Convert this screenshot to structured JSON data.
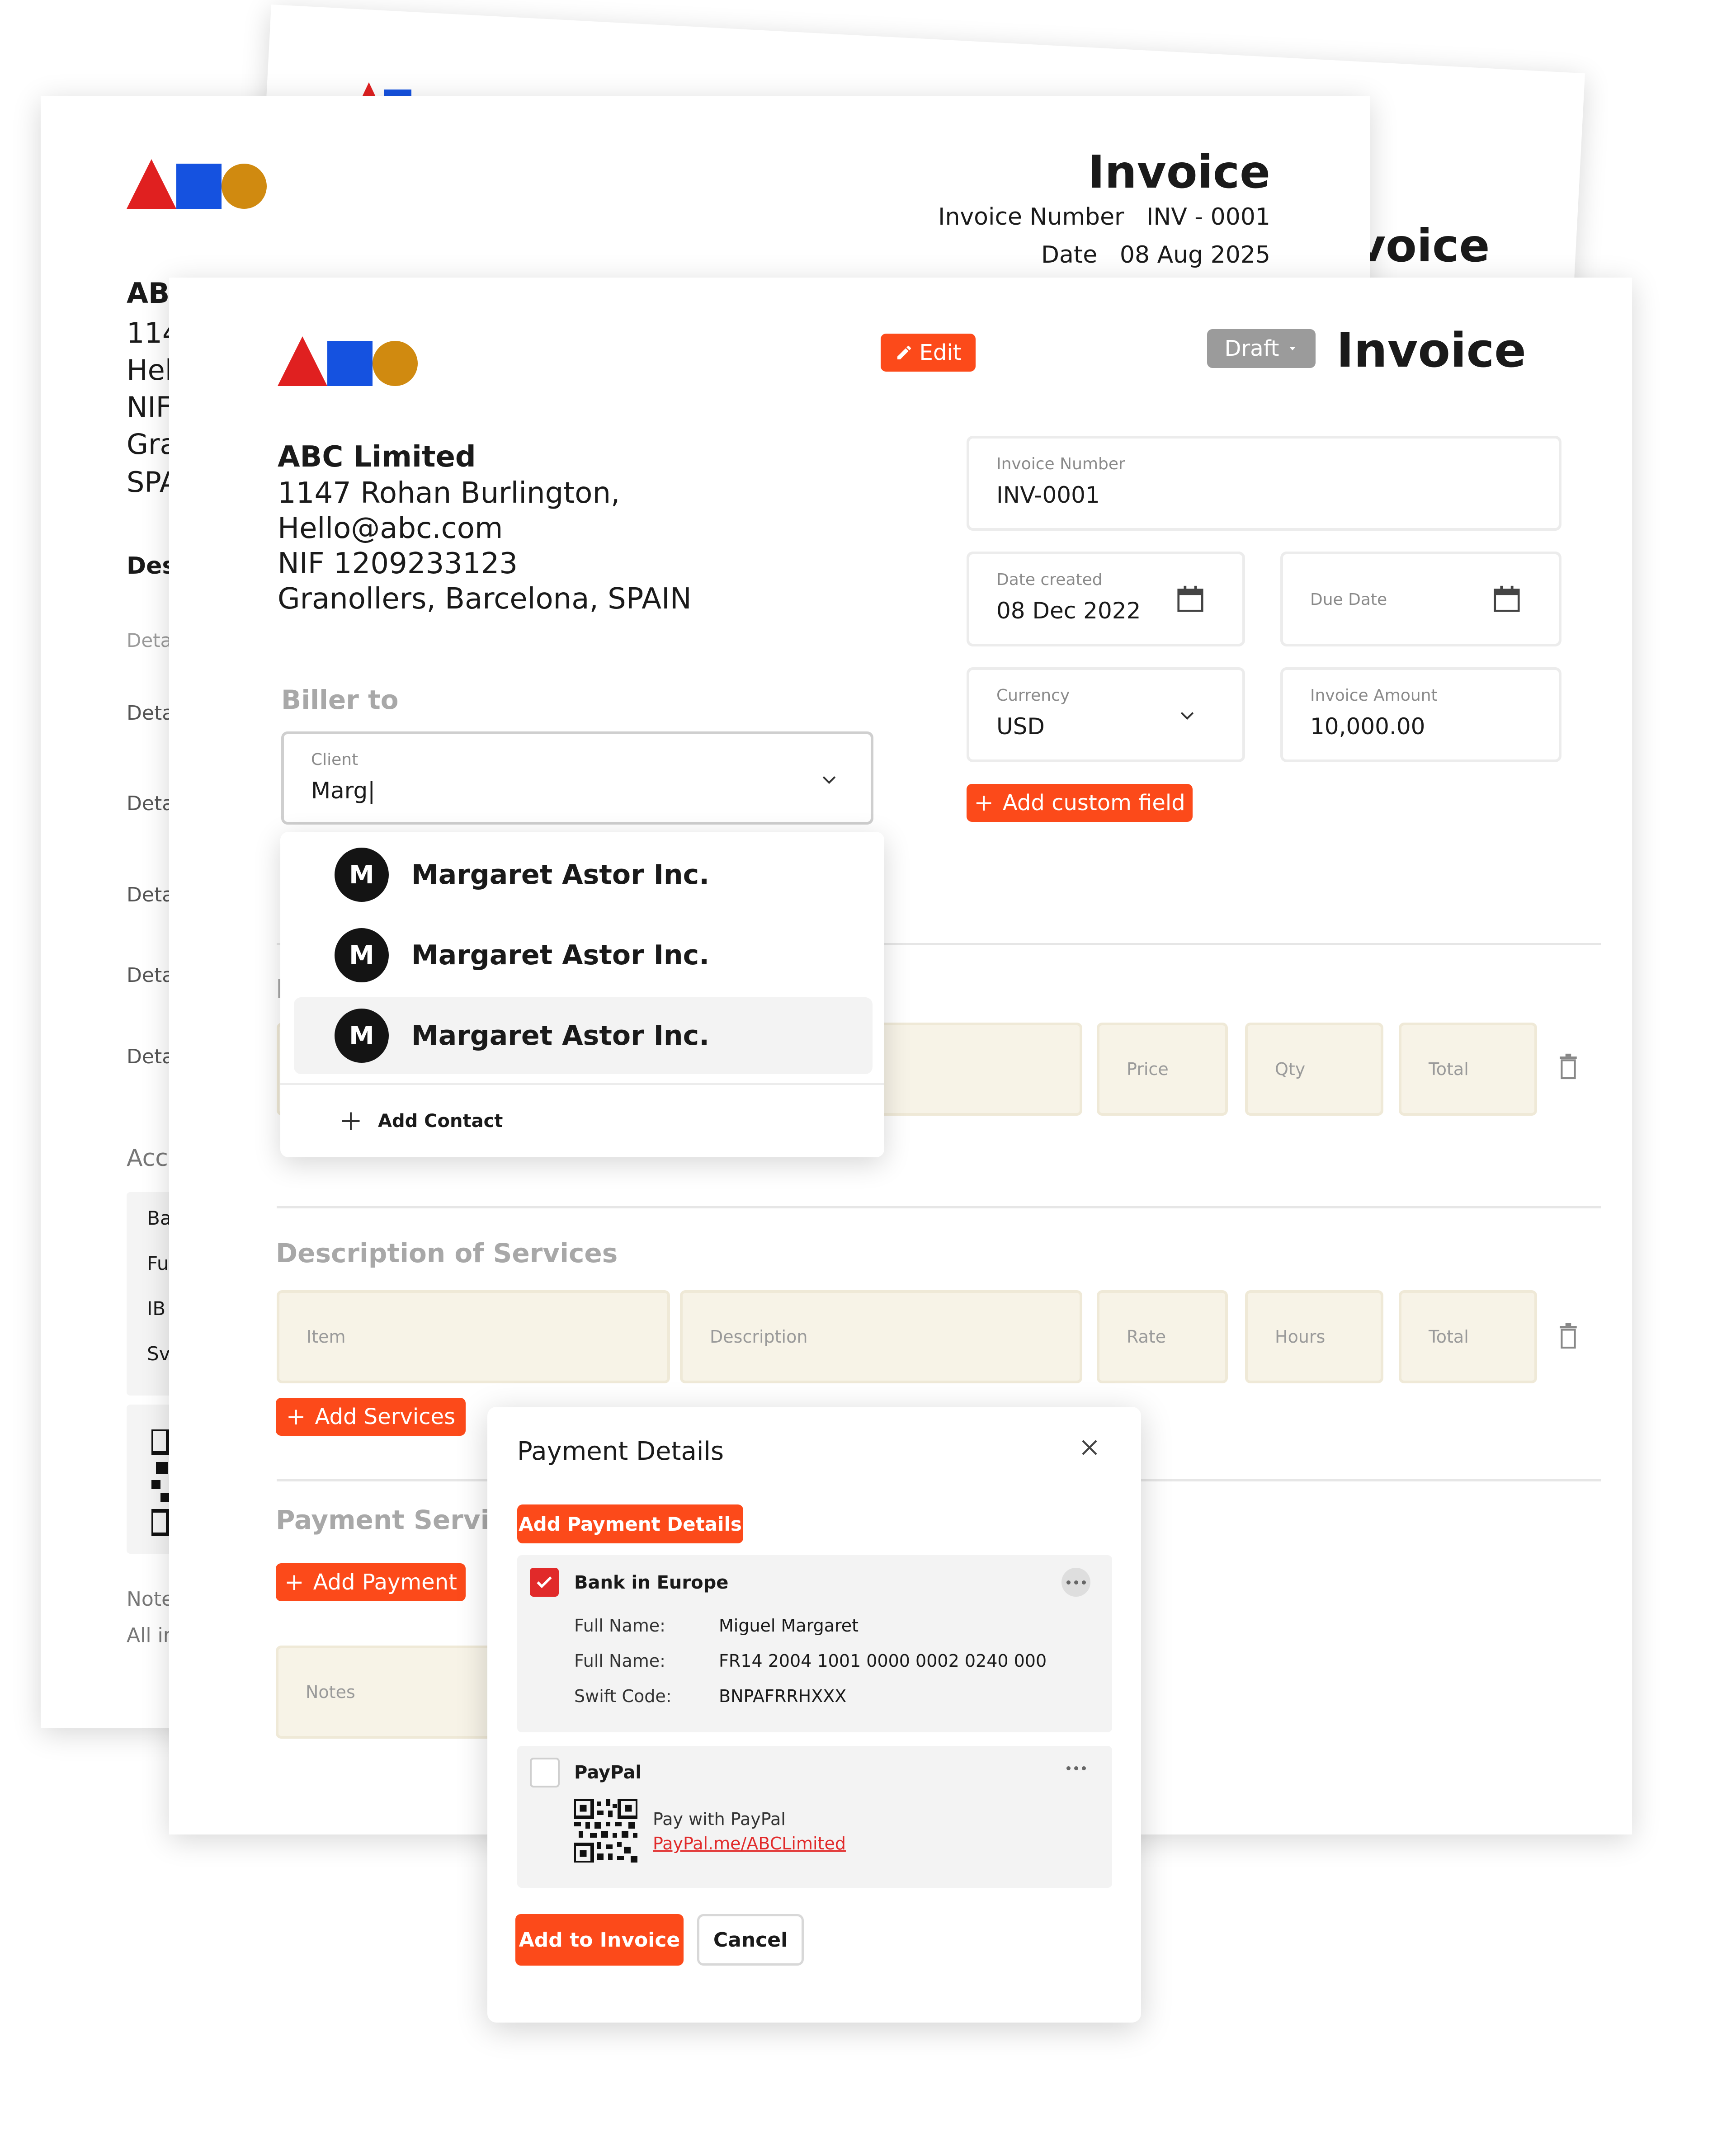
{
  "colors": {
    "accent": "#fc4a1a",
    "draft": "#9b9b9b",
    "logo_red": "#e02020",
    "logo_blue": "#1552e0",
    "logo_yellow": "#d08a10",
    "beige": "#f7f3e7"
  },
  "back_invoice": {
    "title": "Invoice",
    "number_label": "Invoice Number",
    "number_value": "INV - 0001",
    "date_label": "Date",
    "date_value": "08 Aug 2025",
    "left_fragments": [
      "AB",
      "114",
      "Hel",
      "NIF",
      "Gra",
      "SPA"
    ],
    "des": "Des",
    "rows": [
      "Deta",
      "Deta",
      "Deta",
      "Deta",
      "Deta",
      "Deta"
    ],
    "acc": "Acc",
    "acc_rows": [
      "Ba",
      "Fu",
      "IB",
      "Sv"
    ],
    "note": "Note",
    "all": "All ir"
  },
  "third_invoice": {
    "title_fragment": "voice"
  },
  "front": {
    "edit_label": "Edit",
    "draft_label": "Draft",
    "title": "Invoice",
    "company": {
      "name": "ABC Limited",
      "address": "1147 Rohan Burlington,",
      "email": "Hello@abc.com",
      "nif": "NIF 1209233123",
      "city": "Granollers, Barcelona,  SPAIN"
    },
    "biller_title": "Biller to",
    "client": {
      "label": "Client",
      "value": "Marg|"
    },
    "invoice_number": {
      "label": "Invoice Number",
      "value": "INV-0001"
    },
    "date_created": {
      "label": "Date created",
      "value": "08 Dec 2022"
    },
    "due_date": {
      "label": "Due Date"
    },
    "currency": {
      "label": "Currency",
      "value": "USD"
    },
    "invoice_amount": {
      "label": "Invoice Amount",
      "value": "10,000.00"
    },
    "add_custom_field": "Add custom field",
    "items_header": {
      "price": "Price",
      "qty": "Qty",
      "total": "Total"
    },
    "items_title_fragment": "I",
    "services_title": "Description of Services",
    "services_header": {
      "item": "Item",
      "description": "Description",
      "rate": "Rate",
      "hours": "Hours",
      "total": "Total"
    },
    "add_services": "Add Services",
    "payment_services_title": "Payment Servic",
    "add_payment": "Add Payment",
    "notes_placeholder": "Notes"
  },
  "dropdown": {
    "items": [
      {
        "initial": "M",
        "name": "Margaret Astor Inc."
      },
      {
        "initial": "M",
        "name": "Margaret Astor Inc."
      },
      {
        "initial": "M",
        "name": "Margaret Astor Inc."
      }
    ],
    "add_contact": "Add Contact"
  },
  "payment_modal": {
    "title": "Payment Details",
    "add_payment_details": "Add Payment Details",
    "bank": {
      "name": "Bank in Europe",
      "checked": true,
      "rows": [
        {
          "label": "Full Name:",
          "value": "Miguel Margaret"
        },
        {
          "label": "Full Name:",
          "value": "FR14 2004 1001 0000 0002 0240 000"
        },
        {
          "label": "Swift Code:",
          "value": "BNPAFRRHXXX"
        }
      ]
    },
    "paypal": {
      "name": "PayPal",
      "checked": false,
      "pay_with": "Pay with PayPal",
      "link": "PayPal.me/ABCLimited"
    },
    "add_to_invoice": "Add to Invoice",
    "cancel": "Cancel"
  }
}
